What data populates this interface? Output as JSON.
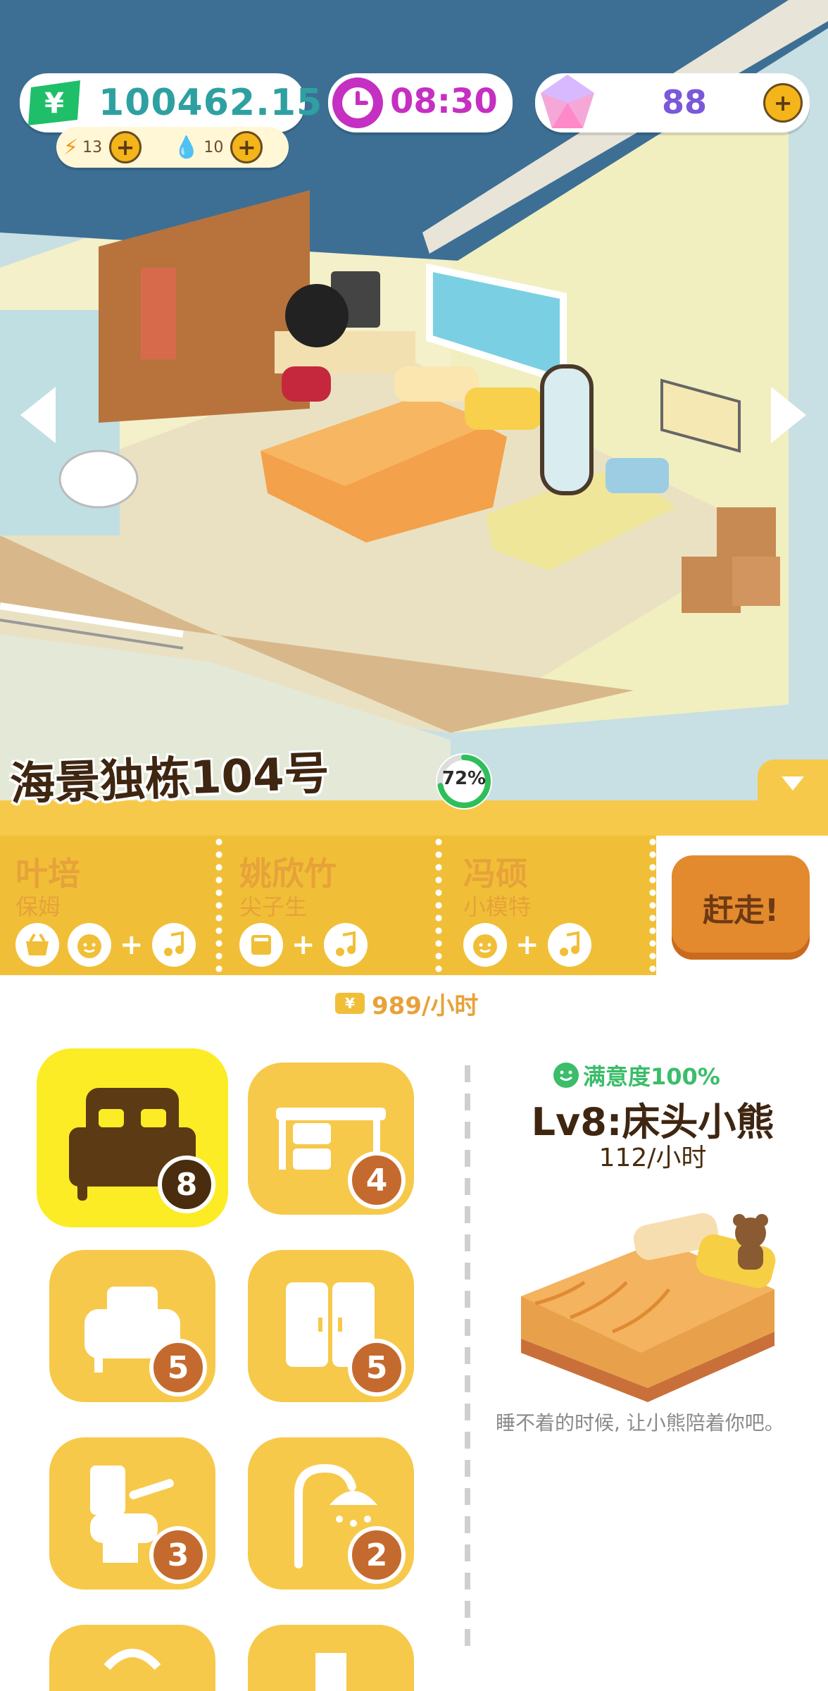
{
  "hud": {
    "money": "100462.15",
    "money_icon": "yen-icon",
    "energy": "13",
    "water": "10",
    "time": "08:30",
    "gems": "88"
  },
  "house": {
    "name": "海景独栋104号",
    "progress_label": "72%",
    "progress": 0.72,
    "income": "989/小时"
  },
  "tenants": [
    {
      "name": "叶培",
      "role": "保姆",
      "needs": [
        "basket-icon",
        "face-icon",
        "music-icon"
      ]
    },
    {
      "name": "姚欣竹",
      "role": "尖子生",
      "needs": [
        "book-icon",
        "music-icon"
      ]
    },
    {
      "name": "冯硕",
      "role": "小模特",
      "needs": [
        "face-icon",
        "music-icon"
      ]
    }
  ],
  "evict_label": "赶走!",
  "categories": [
    {
      "icon": "bed-icon",
      "count": "8",
      "selected": true
    },
    {
      "icon": "desk-icon",
      "count": "4"
    },
    {
      "icon": "sofa-icon",
      "count": "5"
    },
    {
      "icon": "wardrobe-icon",
      "count": "5"
    },
    {
      "icon": "toilet-icon",
      "count": "3"
    },
    {
      "icon": "shower-icon",
      "count": "2"
    }
  ],
  "detail": {
    "satisfaction": "满意度100%",
    "title": "Lv8:床头小熊",
    "rate": "112/小时",
    "description": "睡不着的时候, 让小熊陪着你吧。"
  },
  "colors": {
    "tenant_panel": "#f0bf37",
    "tile": "#f7c94a",
    "tile_selected": "#fcec25",
    "money_text": "#2ea0a2",
    "time_text": "#c52fc2",
    "gem_text": "#7a58d8",
    "satisfaction": "#3bbd6a"
  }
}
